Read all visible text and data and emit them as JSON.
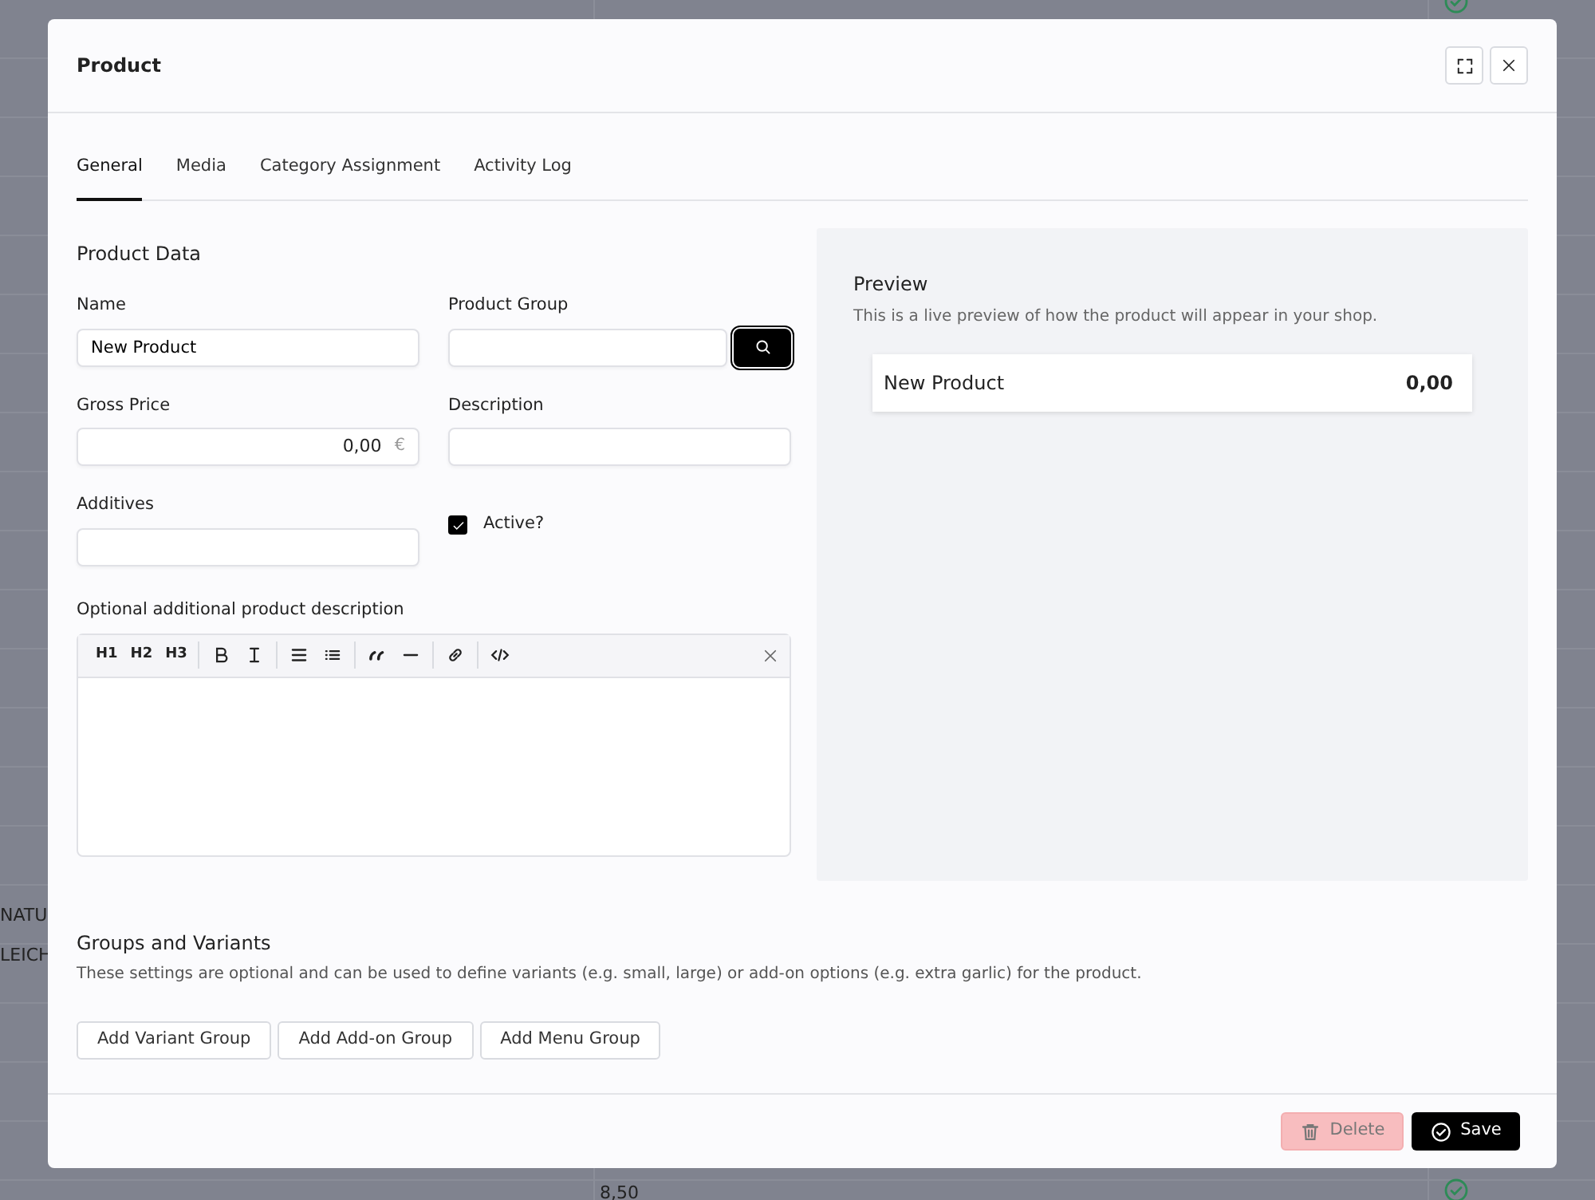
{
  "background": {
    "cells": [
      {
        "text": "NATU",
        "kind": "left1"
      },
      {
        "text": "LEICH",
        "kind": "left2"
      },
      {
        "text": "8,50",
        "kind": "bottom"
      }
    ]
  },
  "modal": {
    "title": "Product",
    "tabs": [
      {
        "label": "General",
        "selected": true
      },
      {
        "label": "Media",
        "selected": false
      },
      {
        "label": "Category Assignment",
        "selected": false
      },
      {
        "label": "Activity Log",
        "selected": false
      }
    ],
    "section_title": "Product Data",
    "fields": {
      "name": {
        "label": "Name",
        "value": "New Product"
      },
      "product_group": {
        "label": "Product Group"
      },
      "gross_price": {
        "label": "Gross Price",
        "value": "0,00",
        "unit": "€"
      },
      "description": {
        "label": "Description"
      },
      "additives": {
        "label": "Additives"
      },
      "active": {
        "label": "Active?",
        "checked": true
      }
    },
    "editor": {
      "label": "Optional additional product description",
      "toolbar": [
        [
          {
            "kind": "heading",
            "label": "H1"
          },
          {
            "kind": "heading",
            "label": "H2"
          },
          {
            "kind": "heading",
            "label": "H3"
          }
        ],
        [
          {
            "kind": "bold"
          },
          {
            "kind": "italic"
          }
        ],
        [
          {
            "kind": "bullet-list"
          },
          {
            "kind": "list"
          }
        ],
        [
          {
            "kind": "quote"
          },
          {
            "kind": "rule"
          }
        ],
        [
          {
            "kind": "link"
          }
        ],
        [
          {
            "kind": "code"
          }
        ]
      ]
    },
    "preview": {
      "title": "Preview",
      "subtitle": "This is a live preview of how the product will appear in your shop.",
      "name": "New Product",
      "price": "0,00"
    },
    "groups": {
      "title": "Groups and Variants",
      "description": "These settings are optional and can be used to define variants (e.g. small, large) or add-on options (e.g. extra garlic) for the product.",
      "buttons": [
        "Add Variant Group",
        "Add Add-on Group",
        "Add Menu Group"
      ]
    },
    "footer": {
      "delete": "Delete",
      "save": "Save"
    }
  }
}
